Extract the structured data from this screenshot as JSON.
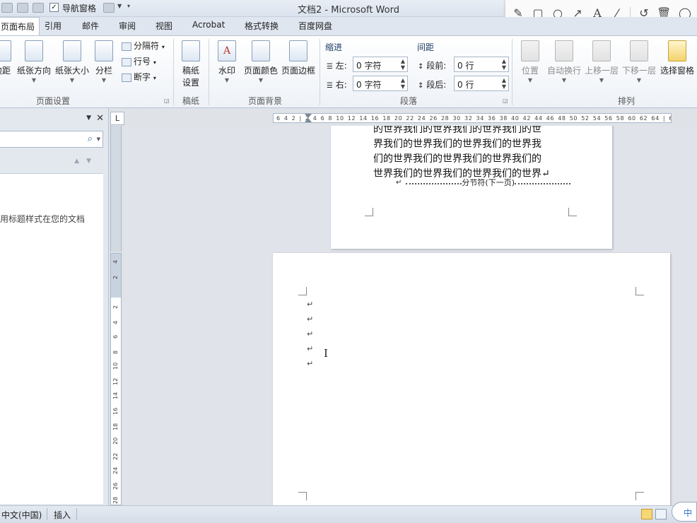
{
  "window": {
    "title": "文档2 - Microsoft Word",
    "qat_nav_pane_label": "导航窗格",
    "qat_nav_pane_checked": "✓"
  },
  "tabs": [
    "页面布局",
    "引用",
    "邮件",
    "审阅",
    "视图",
    "Acrobat",
    "格式转换",
    "百度网盘"
  ],
  "ribbon": {
    "page_setup": {
      "margins": "边距",
      "orientation": "纸张方向",
      "size": "纸张大小",
      "columns": "分栏",
      "breaks": "分隔符",
      "line_numbers": "行号",
      "hyphenation": "断字",
      "label": "页面设置"
    },
    "manuscript": {
      "settings_line1": "稿纸",
      "settings_line2": "设置",
      "label": "稿纸"
    },
    "page_background": {
      "watermark": "水印",
      "page_color": "页面颜色",
      "page_borders": "页面边框",
      "label": "页面背景"
    },
    "paragraph": {
      "indent_title": "缩进",
      "spacing_title": "间距",
      "left_label": "左:",
      "right_label": "右:",
      "left_value": "0 字符",
      "right_value": "0 字符",
      "before_label": "段前:",
      "after_label": "段后:",
      "before_value": "0 行",
      "after_value": "0 行",
      "label": "段落"
    },
    "arrange": {
      "position": "位置",
      "wrap_text": "自动换行",
      "bring_forward": "上移一层",
      "send_backward": "下移一层",
      "selection_pane": "选择窗格",
      "label": "排列"
    }
  },
  "nav_pane": {
    "search_placeholder": "",
    "hint_text": "用标题样式在您的文档"
  },
  "rulers": {
    "corner_glyph": "L",
    "horizontal_ticks": "6 4 2 | 2 4 6 8 10 12 14 16 18 20 22 24 26 28 30 32 34 36 38 40 42 44 46 48 50 52 54 56 58 60 62 64 | 68 70 72",
    "vertical_ticks": [
      "4",
      "2",
      "2",
      "4",
      "6",
      "8",
      "10",
      "12",
      "14",
      "16",
      "18",
      "20",
      "22",
      "24",
      "26",
      "28"
    ]
  },
  "document": {
    "page1_lines": [
      "的世界我们的世界我们的世界我们的世",
      "界我们的世界我们的世界我们的世界我",
      "们的世界我们的世界我们的世界我们的",
      "世界我们的世界我们的世界我们的世界↵"
    ],
    "section_break": "分节符(下一页)",
    "para_mark": "↵",
    "cursor_glyph": "I"
  },
  "statusbar": {
    "language": "中文(中国)",
    "insert_mode": "插入",
    "ime": "中"
  }
}
